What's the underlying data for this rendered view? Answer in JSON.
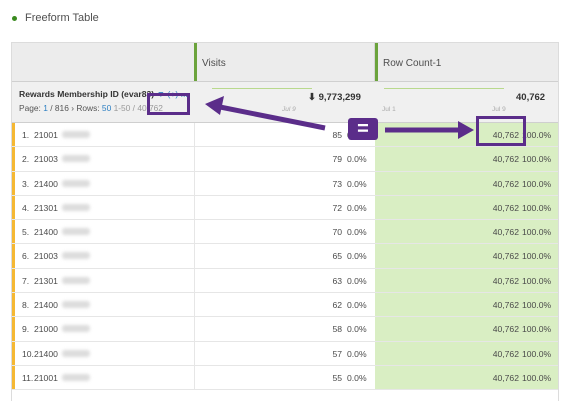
{
  "panel": {
    "title": "Freeform Table"
  },
  "columns": {
    "visits": "Visits",
    "row_count": "Row Count-1"
  },
  "dimension": {
    "name": "Rewards Membership ID (evar83)",
    "filter_text": "(+) ...",
    "page_label": "Page:",
    "page_current": "1",
    "page_total": "/ 816",
    "rows_label": "Rows:",
    "rows_per_page": "50",
    "range": "1-50",
    "total_rows": "40,762"
  },
  "totals": {
    "visits": "⬇ 9,773,299",
    "visits_date": "Jul 9",
    "row_count": "40,762",
    "row_count_start": "Jul 1",
    "row_count_end": "Jul 9"
  },
  "annotation": {
    "equals": "="
  },
  "rows": [
    {
      "idx": "1.",
      "id": "21001",
      "visits": "85",
      "vpct": "0.0%",
      "rc": "40,762",
      "rpct": "100.0%"
    },
    {
      "idx": "2.",
      "id": "21003",
      "visits": "79",
      "vpct": "0.0%",
      "rc": "40,762",
      "rpct": "100.0%"
    },
    {
      "idx": "3.",
      "id": "21400",
      "visits": "73",
      "vpct": "0.0%",
      "rc": "40,762",
      "rpct": "100.0%"
    },
    {
      "idx": "4.",
      "id": "21301",
      "visits": "72",
      "vpct": "0.0%",
      "rc": "40,762",
      "rpct": "100.0%"
    },
    {
      "idx": "5.",
      "id": "21400",
      "visits": "70",
      "vpct": "0.0%",
      "rc": "40,762",
      "rpct": "100.0%"
    },
    {
      "idx": "6.",
      "id": "21003",
      "visits": "65",
      "vpct": "0.0%",
      "rc": "40,762",
      "rpct": "100.0%"
    },
    {
      "idx": "7.",
      "id": "21301",
      "visits": "63",
      "vpct": "0.0%",
      "rc": "40,762",
      "rpct": "100.0%"
    },
    {
      "idx": "8.",
      "id": "21400",
      "visits": "62",
      "vpct": "0.0%",
      "rc": "40,762",
      "rpct": "100.0%"
    },
    {
      "idx": "9.",
      "id": "21000",
      "visits": "58",
      "vpct": "0.0%",
      "rc": "40,762",
      "rpct": "100.0%"
    },
    {
      "idx": "10.",
      "id": "21400",
      "visits": "57",
      "vpct": "0.0%",
      "rc": "40,762",
      "rpct": "100.0%"
    },
    {
      "idx": "11.",
      "id": "21001",
      "visits": "55",
      "vpct": "0.0%",
      "rc": "40,762",
      "rpct": "100.0%"
    }
  ],
  "colors": {
    "accent_green": "#6ba33c",
    "highlight_purple": "#5b2d8a",
    "row_count_fill": "#d9eec3",
    "left_bar": "#f5b833"
  }
}
